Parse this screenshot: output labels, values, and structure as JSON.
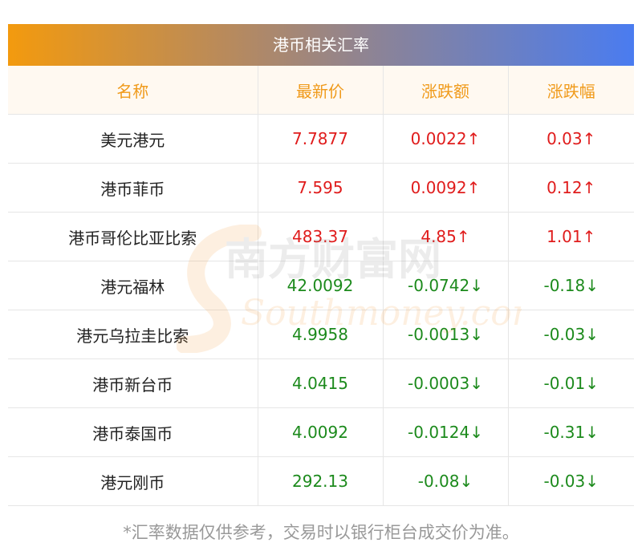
{
  "banner": {
    "title": "港币相关汇率"
  },
  "table": {
    "headers": [
      "名称",
      "最新价",
      "涨跌额",
      "涨跌幅"
    ],
    "rows": [
      {
        "name": "美元港元",
        "price": "7.7877",
        "change": "0.0022↑",
        "pct": "0.03↑",
        "dir": "up"
      },
      {
        "name": "港币菲币",
        "price": "7.595",
        "change": "0.0092↑",
        "pct": "0.12↑",
        "dir": "up"
      },
      {
        "name": "港币哥伦比亚比索",
        "price": "483.37",
        "change": "4.85↑",
        "pct": "1.01↑",
        "dir": "up"
      },
      {
        "name": "港元福林",
        "price": "42.0092",
        "change": "-0.0742↓",
        "pct": "-0.18↓",
        "dir": "down"
      },
      {
        "name": "港元乌拉圭比索",
        "price": "4.9958",
        "change": "-0.0013↓",
        "pct": "-0.03↓",
        "dir": "down"
      },
      {
        "name": "港币新台币",
        "price": "4.0415",
        "change": "-0.0003↓",
        "pct": "-0.01↓",
        "dir": "down"
      },
      {
        "name": "港币泰国币",
        "price": "4.0092",
        "change": "-0.0124↓",
        "pct": "-0.31↓",
        "dir": "down"
      },
      {
        "name": "港元刚币",
        "price": "292.13",
        "change": "-0.08↓",
        "pct": "-0.03↓",
        "dir": "down"
      }
    ]
  },
  "watermark": {
    "cn": "南方财富网",
    "en": "Southmoney.com"
  },
  "footnote": "*汇率数据仅供参考，交易时以银行柜台成交价为准。",
  "colors": {
    "up": "#e01c1c",
    "down": "#1c8a1c",
    "header_text": "#f09a1a",
    "gradient_start": "#f39a0e",
    "gradient_end": "#4a7cf0"
  }
}
